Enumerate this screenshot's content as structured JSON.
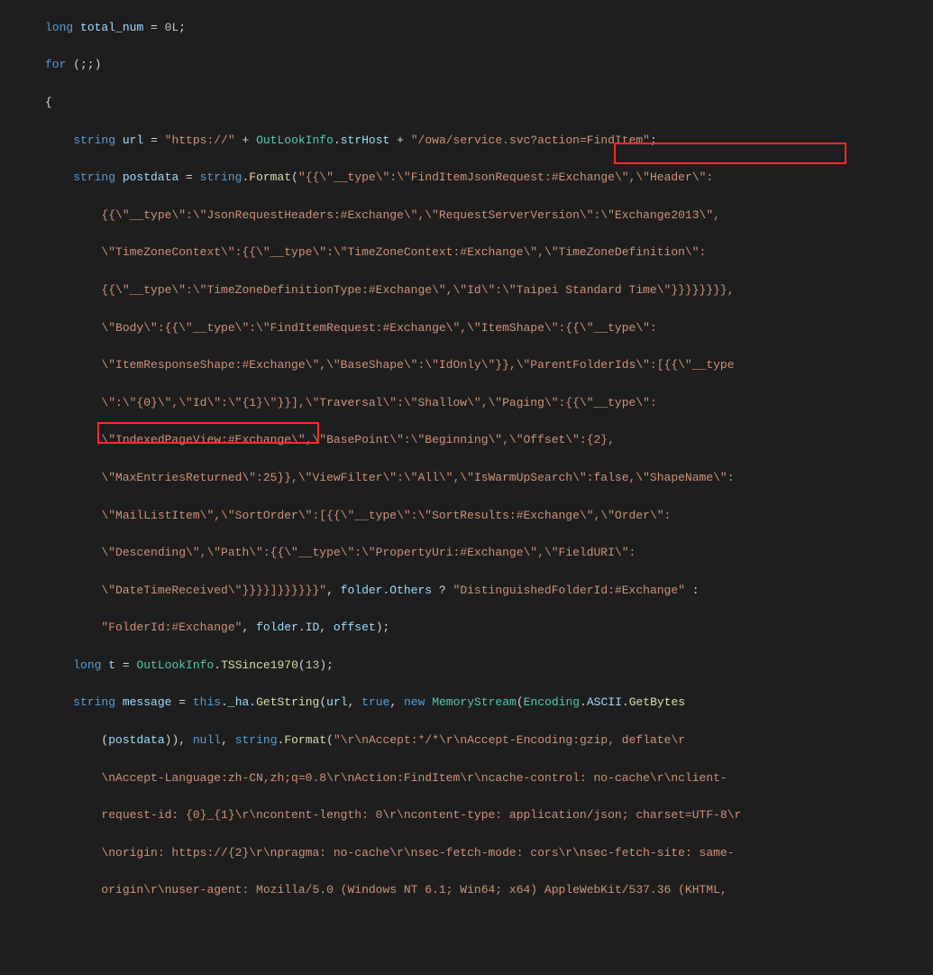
{
  "code": {
    "l00_kw_long": "long",
    "l00_var": "total_num",
    "l00_eq": " = ",
    "l00_num": "0L",
    "l00_sc": ";",
    "l01_kw": "for",
    "l01_rest": " (;;)",
    "l02": "{",
    "l03_type": "string",
    "l03_var": " url",
    "l03_eq": " = ",
    "l03_s1": "\"https://\"",
    "l03_plus1": " + ",
    "l03_cls": "OutLookInfo",
    "l03_dot1": ".",
    "l03_var2": "strHost",
    "l03_plus2": " + ",
    "l03_s2": "\"/owa/service.svc?action=FindItem\"",
    "l03_sc": ";",
    "l04_type": "string",
    "l04_var": " postdata",
    "l04_eq": " = ",
    "l04_kw": "string",
    "l04_dot": ".",
    "l04_fn": "Format",
    "l04_p": "(",
    "l04_s": "\"{{\\\"__type\\\":\\\"FindItemJsonRequest:#Exchange\\\",\\\"Header\\\":",
    "l05": "{{\\\"__type\\\":\\\"JsonRequestHeaders:#Exchange\\\",\\\"RequestServerVersion\\\":\\\"Exchange2013\\\",",
    "l06": "\\\"TimeZoneContext\\\":{{\\\"__type\\\":\\\"TimeZoneContext:#Exchange\\\",\\\"TimeZoneDefinition\\\":",
    "l07": "{{\\\"__type\\\":\\\"TimeZoneDefinitionType:#Exchange\\\",\\\"Id\\\":\\\"Taipei Standard Time\\\"}}}}}}}},",
    "l08": "\\\"Body\\\":{{\\\"__type\\\":\\\"FindItemRequest:#Exchange\\\",\\\"ItemShape\\\":{{\\\"__type\\\":",
    "l09": "\\\"ItemResponseShape:#Exchange\\\",\\\"BaseShape\\\":\\\"IdOnly\\\"}},\\\"ParentFolderIds\\\":[{{\\\"__type",
    "l10": "\\\":\\\"{0}\\\",\\\"Id\\\":\\\"{1}\\\"}}],\\\"Traversal\\\":\\\"Shallow\\\",\\\"Paging\\\":{{\\\"__type\\\":",
    "l11": "\\\"IndexedPageView:#Exchange\\\",\\\"BasePoint\\\":\\\"Beginning\\\",\\\"Offset\\\":{2},",
    "l12": "\\\"MaxEntriesReturned\\\":25}},\\\"ViewFilter\\\":\\\"All\\\",\\\"IsWarmUpSearch\\\":false,\\\"ShapeName\\\":",
    "l13": "\\\"MailListItem\\\",\\\"SortOrder\\\":[{{\\\"__type\\\":\\\"SortResults:#Exchange\\\",\\\"Order\\\":",
    "l14": "\\\"Descending\\\",\\\"Path\\\":{{\\\"__type\\\":\\\"PropertyUri:#Exchange\\\",\\\"FieldURI\\\":",
    "l15_s": "\\\"DateTimeReceived\\\"}}}}]}}}}}}\"",
    "l15_c1": ", ",
    "l15_var": "folder",
    "l15_dot": ".",
    "l15_fld": "Others",
    "l15_tern": " ? ",
    "l15_s2": "\"DistinguishedFolderId:#Exchange\"",
    "l15_colon": " :",
    "l16_s": "\"FolderId:#Exchange\"",
    "l16_c1": ", ",
    "l16_var": "folder",
    "l16_dot": ".",
    "l16_fld": "ID",
    "l16_c2": ", ",
    "l16_off": "offset",
    "l16_p": ");",
    "l17_type": "long",
    "l17_var": " t",
    "l17_eq": " = ",
    "l17_cls": "OutLookInfo",
    "l17_dot": ".",
    "l17_fn": "TSSince1970",
    "l17_p": "(",
    "l17_num": "13",
    "l17_p2": ");",
    "l18_type": "string",
    "l18_var": " message",
    "l18_eq": " = ",
    "l18_this": "this",
    "l18_dot1": ".",
    "l18_fld": "_ha",
    "l18_dot2": ".",
    "l18_fn": "GetString",
    "l18_p": "(",
    "l18_url": "url",
    "l18_c1": ", ",
    "l18_true": "true",
    "l18_c2": ", ",
    "l18_new": "new",
    "l18_sp": " ",
    "l18_cls": "MemoryStream",
    "l18_p2": "(",
    "l18_enc": "Encoding",
    "l18_dot3": ".",
    "l18_asc": "ASCII",
    "l18_dot4": ".",
    "l18_gb": "GetBytes",
    "l19_p": "(",
    "l19_pd": "postdata",
    "l19_p2": ")), ",
    "l19_null": "null",
    "l19_c": ", ",
    "l19_kw": "string",
    "l19_dot": ".",
    "l19_fn": "Format",
    "l19_p3": "(",
    "l19_s": "\"\\r\\nAccept:*/*\\r\\nAccept-Encoding:gzip, deflate\\r",
    "l20": "\\nAccept-Language:zh-CN,zh;q=0.8\\r\\nAction:FindItem\\r\\ncache-control: no-cache\\r\\nclient-",
    "l21": "request-id: {0}_{1}\\r\\ncontent-length: 0\\r\\ncontent-type: application/json; charset=UTF-8\\r",
    "l22": "\\norigin: https://{2}\\r\\npragma: no-cache\\r\\nsec-fetch-mode: cors\\r\\nsec-fetch-site: same-",
    "l23": "origin\\r\\nuser-agent: Mozilla/5.0 (Windows NT 6.1; Win64; x64) AppleWebKit/537.36 (KHTML,"
  },
  "highlights": {
    "box1_desc": "Taipei Standard Time string literal highlight",
    "box2_desc": "Accept-Language zh-CN header highlight"
  }
}
